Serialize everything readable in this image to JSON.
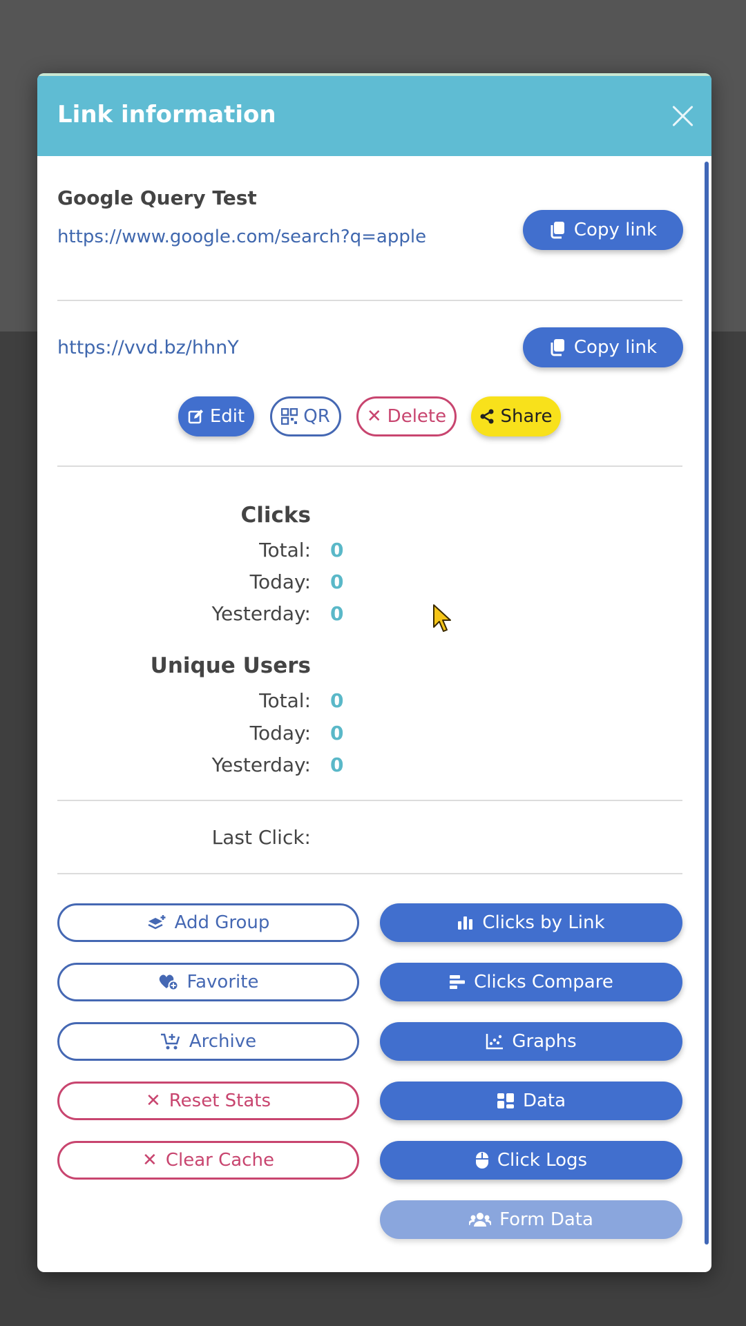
{
  "modal": {
    "title": "Link information",
    "link_name": "Google Query Test",
    "destination_url": "https://www.google.com/search?q=apple",
    "short_url": "https://vvd.bz/hhnY",
    "copy_link_label": "Copy link",
    "actions": {
      "edit": "Edit",
      "qr": "QR",
      "delete": "Delete",
      "share": "Share"
    },
    "clicks": {
      "heading": "Clicks",
      "total_label": "Total:",
      "total": "0",
      "today_label": "Today:",
      "today": "0",
      "yesterday_label": "Yesterday:",
      "yesterday": "0"
    },
    "unique_users": {
      "heading": "Unique Users",
      "total_label": "Total:",
      "total": "0",
      "today_label": "Today:",
      "today": "0",
      "yesterday_label": "Yesterday:",
      "yesterday": "0"
    },
    "last_click_label": "Last Click:",
    "left_buttons": {
      "add_group": "Add Group",
      "favorite": "Favorite",
      "archive": "Archive",
      "reset_stats": "Reset Stats",
      "clear_cache": "Clear Cache"
    },
    "right_buttons": {
      "clicks_by_link": "Clicks by Link",
      "clicks_compare": "Clicks Compare",
      "graphs": "Graphs",
      "data": "Data",
      "click_logs": "Click Logs",
      "form_data": "Form Data"
    }
  },
  "colors": {
    "header": "#5fbcd3",
    "primary": "#416fce",
    "danger": "#c8456f",
    "share": "#f8e11b",
    "stat_value": "#5ab8c8"
  }
}
